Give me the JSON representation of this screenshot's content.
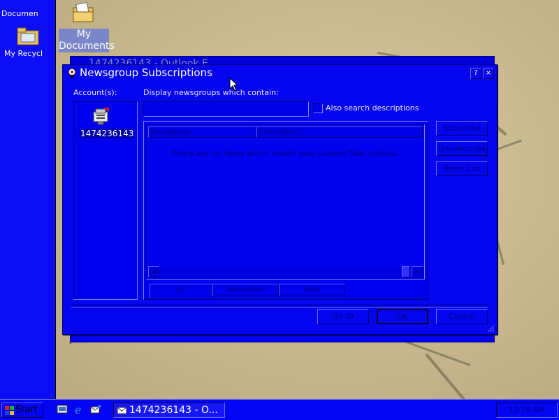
{
  "desktop": {
    "left_icon_1_label": "Documen",
    "left_icon_2_label": "My Recycl",
    "mydocs_label": "My Documents"
  },
  "background_window": {
    "title": "1474236143 - Outlook E"
  },
  "dialog": {
    "title": "Newsgroup Subscriptions",
    "help_button": "?",
    "close_button": "×",
    "accounts_label": "Account(s):",
    "account_name": "1474236143",
    "filter_label": "Display newsgroups which contain:",
    "filter_value": "",
    "also_search_label": "Also search descriptions",
    "col_newsgroup": "Newsgroup",
    "col_description": "Description",
    "empty_message": "There are no items which match your current filter options.",
    "tabs": [
      "All",
      "Subscribed",
      "New"
    ],
    "btn_subscribe": "Subscribe",
    "btn_unsubscribe": "Unsubscribe",
    "btn_reset": "Reset List",
    "btn_goto": "Go to",
    "btn_ok": "OK",
    "btn_cancel": "Cancel"
  },
  "taskbar": {
    "start_label": "Start",
    "task_label": "1474236143 - O...",
    "clock": "12:18 AM"
  }
}
